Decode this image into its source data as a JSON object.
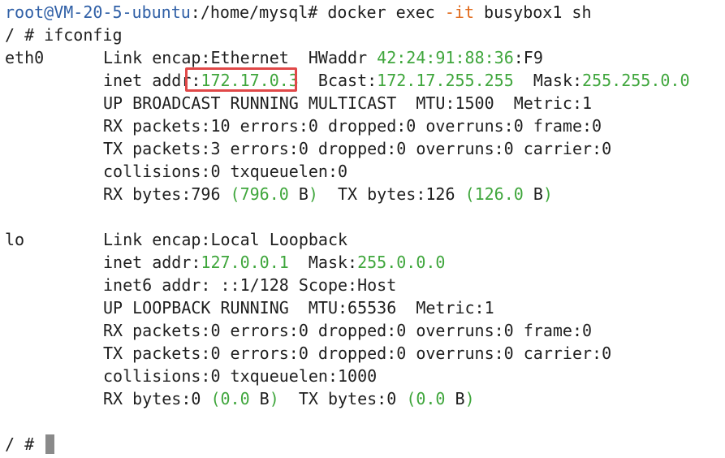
{
  "prompt_line": {
    "user_host": "root@VM-20-5-ubuntu",
    "path": ":/home/mysql#",
    "cmd": "docker exec",
    "flag": "-it",
    "args": "busybox1 sh"
  },
  "inner_cmd": {
    "prompt": "/ #",
    "cmd": "ifconfig"
  },
  "eth0": {
    "name": "eth0",
    "link": "Link encap:Ethernet  HWaddr ",
    "hwaddr": "42:24:91:88:36",
    "hwaddr_tail": ":F9",
    "inet_label": "inet addr:",
    "inet_addr": "172.17.0.3",
    "bcast_label": "  Bcast:",
    "bcast": "172.17.255.255",
    "mask_label": "  Mask:",
    "mask": "255.255.0.0",
    "flags": "UP BROADCAST RUNNING MULTICAST  MTU:1500  Metric:1",
    "rx_packets": "RX packets:10 errors:0 dropped:0 overruns:0 frame:0",
    "tx_packets": "TX packets:3 errors:0 dropped:0 overruns:0 carrier:0",
    "collisions": "collisions:0 txqueuelen:0",
    "rx_bytes_label": "RX bytes:796 ",
    "rx_bytes_paren": "(796.0",
    "rx_bytes_unit": " B",
    "rx_bytes_close": ")",
    "tx_bytes_label": "  TX bytes:126 ",
    "tx_bytes_paren": "(126.0",
    "tx_bytes_unit": " B",
    "tx_bytes_close": ")"
  },
  "lo": {
    "name": "lo",
    "link": "Link encap:Local Loopback",
    "inet_label": "inet addr:",
    "inet_addr": "127.0.0.1",
    "mask_label": "  Mask:",
    "mask": "255.0.0.0",
    "inet6": "inet6 addr: ::1/128 Scope:Host",
    "flags": "UP LOOPBACK RUNNING  MTU:65536  Metric:1",
    "rx_packets": "RX packets:0 errors:0 dropped:0 overruns:0 frame:0",
    "tx_packets": "TX packets:0 errors:0 dropped:0 overruns:0 carrier:0",
    "collisions": "collisions:0 txqueuelen:1000",
    "rx_bytes_label": "RX bytes:0 ",
    "rx_bytes_paren": "(0.0",
    "rx_bytes_unit": " B",
    "rx_bytes_close": ")",
    "tx_bytes_label": "  TX bytes:0 ",
    "tx_bytes_paren": "(0.0",
    "tx_bytes_unit": " B",
    "tx_bytes_close": ")"
  },
  "final_prompt": "/ #",
  "colors": {
    "prompt_blue": "#2f5fa6",
    "flag_orange": "#e0691a",
    "value_green": "#3fa63c",
    "highlight_red": "#e04848"
  }
}
